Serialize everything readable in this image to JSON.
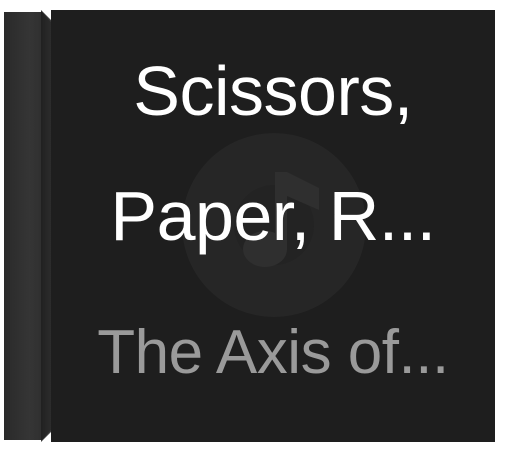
{
  "album": {
    "title_line1": "Scissors,",
    "title_line2": "Paper, R...",
    "artist": "The Axis of...",
    "placeholder_icon": "music-note-icon"
  },
  "colors": {
    "cover_background": "#1e1e1e",
    "spine": "#333333",
    "title_text": "#ffffff",
    "artist_text": "#9a9a9a",
    "icon_tint": "#2c2c2c"
  }
}
